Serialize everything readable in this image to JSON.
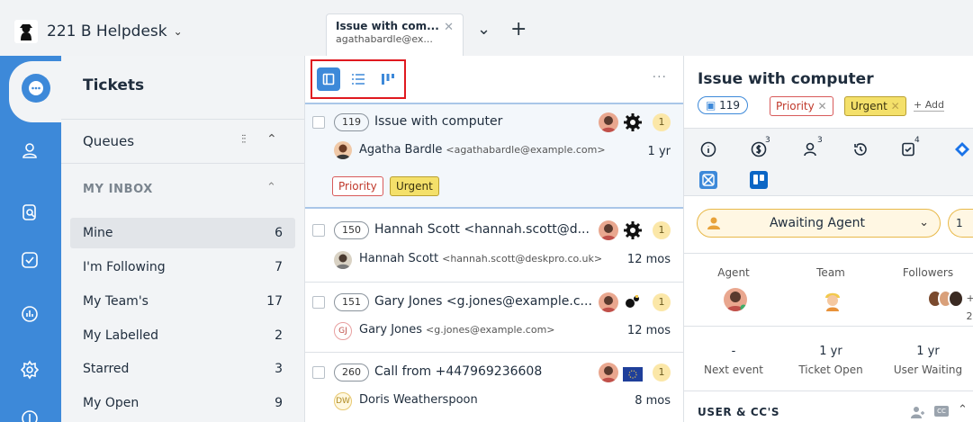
{
  "app": {
    "name": "221 B Helpdesk"
  },
  "tab": {
    "title": "Issue with com...",
    "subtitle": "agathabardle@ex..."
  },
  "tickets_panel": {
    "title": "Tickets",
    "queues_label": "Queues",
    "inbox_header": "MY INBOX",
    "items": [
      {
        "label": "Mine",
        "count": "6",
        "active": true
      },
      {
        "label": "I'm Following",
        "count": "7"
      },
      {
        "label": "My Team's",
        "count": "17"
      },
      {
        "label": "My Labelled",
        "count": "2"
      },
      {
        "label": "Starred",
        "count": "3"
      },
      {
        "label": "My Open",
        "count": "9"
      }
    ]
  },
  "list": {
    "more": "···",
    "tickets": [
      {
        "id": "119",
        "subject": "Issue with computer",
        "requester": "Agatha Bardle",
        "email": "<agathabardle@example.com>",
        "age": "1 yr",
        "badge": "1",
        "labels": [
          "Priority",
          "Urgent"
        ]
      },
      {
        "id": "150",
        "subject": "Hannah Scott <hannah.scott@d...",
        "requester": "Hannah Scott",
        "email": "<hannah.scott@deskpro.co.uk>",
        "age": "12 mos",
        "badge": "1"
      },
      {
        "id": "151",
        "subject": "Gary Jones <g.jones@example.c...",
        "requester": "Gary Jones",
        "email": "<g.jones@example.com>",
        "age": "12 mos",
        "badge": "1",
        "initials": "GJ"
      },
      {
        "id": "260",
        "subject": "Call from +447969236608",
        "requester": "Doris Weatherspoon",
        "email": "",
        "age": "8 mos",
        "badge": "1",
        "initials": "DW"
      }
    ]
  },
  "detail": {
    "title": "Issue with computer",
    "id": "119",
    "tags": [
      "Priority",
      "Urgent"
    ],
    "add_label": "+ Add",
    "tab_counts": {
      "billing": "3",
      "users": "3",
      "attachments": "4"
    },
    "status": {
      "label": "Awaiting Agent",
      "count": "1"
    },
    "headers": {
      "agent": "Agent",
      "team": "Team",
      "followers": "Followers"
    },
    "followers_extra": "+ 2",
    "stats": [
      {
        "value": "-",
        "label": "Next event"
      },
      {
        "value": "1 yr",
        "label": "Ticket Open"
      },
      {
        "value": "1 yr",
        "label": "User Waiting"
      }
    ],
    "users_header": "USER & CC'S"
  },
  "colors": {
    "accent": "#3d89d9",
    "rail": "#3d89d9",
    "highlight_border": "#e0191f",
    "urgent": "#f4e06a",
    "priority": "#c0392b"
  }
}
